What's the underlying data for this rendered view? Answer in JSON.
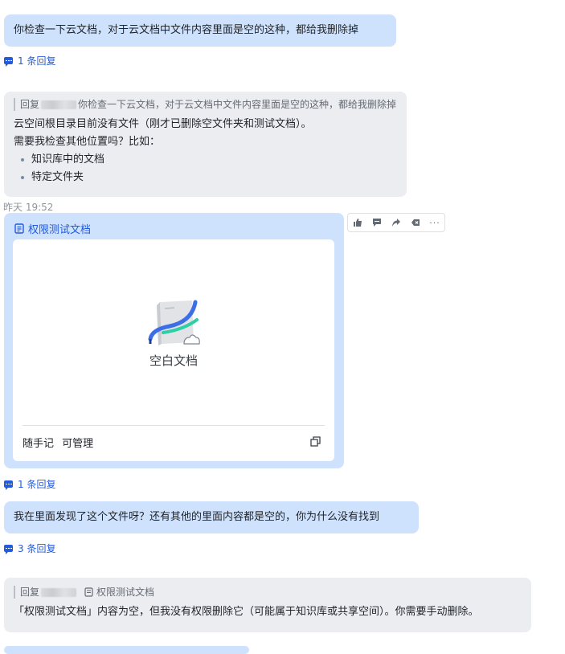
{
  "messages": {
    "m1": {
      "text": "你检查一下云文档，对于云文档中文件内容里面是空的这种，都给我删除掉",
      "replies": "1 条回复"
    },
    "m2": {
      "quote_prefix": "回复",
      "quote_text": "你检查一下云文档，对于云文档中文件内容里面是空的这种，都给我删除掉",
      "line1": "云空间根目录目前没有文件（刚才已删除空文件夹和测试文档）。",
      "line2": "需要我检查其他位置吗？比如：",
      "bullets": [
        "知识库中的文档",
        "特定文件夹"
      ],
      "timestamp": "昨天 19:52"
    },
    "m3": {
      "doc_title": "权限测试文档",
      "preview_label": "空白文档",
      "footer_left": "随手记",
      "footer_perm": "可管理",
      "replies": "1 条回复"
    },
    "m4": {
      "text": "我在里面发现了这个文件呀？还有其他的里面内容都是空的，你为什么没有找到",
      "replies": "3 条回复"
    },
    "m5": {
      "quote_prefix": "回复",
      "quote_doc": "权限测试文档",
      "text": "「权限测试文档」内容为空，但我没有权限删除它（可能属于知识库或共享空间）。你需要手动删除。"
    }
  },
  "toolbar": {
    "like": "👍",
    "comment": "💬",
    "forward": "➦",
    "pin": "🏷",
    "more": "···"
  },
  "colors": {
    "accent": "#245bdb",
    "my_bubble": "#cfe2fd",
    "bot_bubble": "#ebedf0"
  },
  "icons": [
    "reply-icon",
    "doc-icon",
    "copy-icon",
    "like-icon",
    "comment-icon",
    "forward-icon",
    "tag-icon",
    "more-icon"
  ]
}
